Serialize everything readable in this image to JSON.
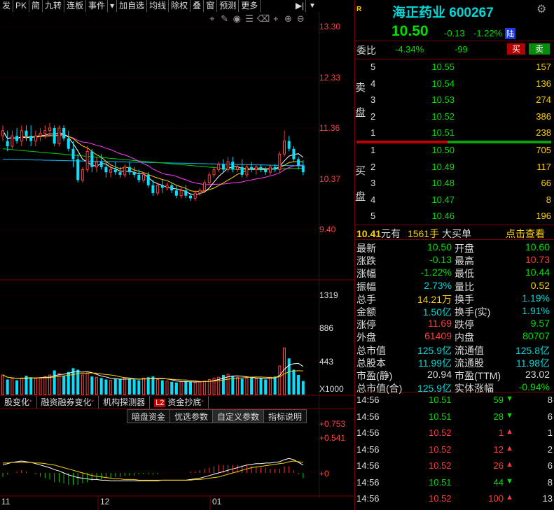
{
  "toolbar": {
    "items": [
      "发",
      "PK",
      "简",
      "九转",
      "连板",
      "事件",
      "▾",
      "加自选",
      "均线",
      "除权",
      "叠",
      "窗",
      "预测",
      "更多"
    ],
    "nav_icon": "step-right-icon",
    "dropdown_icon": "caret-down-icon"
  },
  "chart": {
    "price_axis": [
      "13.30",
      "12.33",
      "11.36",
      "10.37",
      "9.40"
    ],
    "volume_axis": [
      "1319",
      "886",
      "443",
      "X1000"
    ],
    "indicator_axis": [
      "+0.753",
      "+0.541",
      "+0"
    ],
    "date_labels": [
      "11",
      "12",
      "01"
    ],
    "tools": [
      "crosshair-icon",
      "brush-icon",
      "eye-icon",
      "layers-icon",
      "trash-icon",
      "plus-icon",
      "zoom-in-icon",
      "zoom-out-icon"
    ]
  },
  "chart_data": {
    "type": "candlestick",
    "price_ylim": [
      9.4,
      13.3
    ],
    "volume_ylim": [
      0,
      1319
    ],
    "candles": [
      {
        "o": 11.2,
        "h": 11.4,
        "l": 11.1,
        "c": 11.3
      },
      {
        "o": 11.1,
        "h": 11.3,
        "l": 10.9,
        "c": 11.0
      },
      {
        "o": 11.0,
        "h": 11.3,
        "l": 10.95,
        "c": 11.2
      },
      {
        "o": 11.2,
        "h": 11.35,
        "l": 11.05,
        "c": 11.1
      },
      {
        "o": 11.1,
        "h": 11.4,
        "l": 11.0,
        "c": 11.3
      },
      {
        "o": 11.3,
        "h": 11.4,
        "l": 11.1,
        "c": 11.2
      },
      {
        "o": 11.2,
        "h": 11.4,
        "l": 11.0,
        "c": 11.1
      },
      {
        "o": 11.1,
        "h": 11.3,
        "l": 11.0,
        "c": 11.2
      },
      {
        "o": 11.2,
        "h": 11.35,
        "l": 11.1,
        "c": 11.25
      },
      {
        "o": 11.25,
        "h": 11.4,
        "l": 11.15,
        "c": 11.3
      },
      {
        "o": 11.3,
        "h": 11.45,
        "l": 11.2,
        "c": 11.35
      },
      {
        "o": 11.35,
        "h": 11.4,
        "l": 11.0,
        "c": 11.05
      },
      {
        "o": 11.05,
        "h": 11.4,
        "l": 11.0,
        "c": 11.35
      },
      {
        "o": 11.35,
        "h": 11.4,
        "l": 11.1,
        "c": 11.15
      },
      {
        "o": 11.15,
        "h": 11.3,
        "l": 10.9,
        "c": 10.95
      },
      {
        "o": 10.95,
        "h": 11.1,
        "l": 10.6,
        "c": 10.75
      },
      {
        "o": 10.75,
        "h": 10.85,
        "l": 10.3,
        "c": 10.35
      },
      {
        "o": 10.35,
        "h": 10.6,
        "l": 10.3,
        "c": 10.55
      },
      {
        "o": 10.55,
        "h": 11.0,
        "l": 10.5,
        "c": 10.9
      },
      {
        "o": 10.9,
        "h": 10.95,
        "l": 10.5,
        "c": 10.6
      },
      {
        "o": 10.6,
        "h": 10.8,
        "l": 10.5,
        "c": 10.7
      },
      {
        "o": 10.7,
        "h": 10.85,
        "l": 10.55,
        "c": 10.6
      },
      {
        "o": 10.6,
        "h": 10.7,
        "l": 10.4,
        "c": 10.5
      },
      {
        "o": 10.5,
        "h": 10.65,
        "l": 10.4,
        "c": 10.55
      },
      {
        "o": 10.55,
        "h": 10.7,
        "l": 10.45,
        "c": 10.5
      },
      {
        "o": 10.5,
        "h": 10.6,
        "l": 10.4,
        "c": 10.45
      },
      {
        "o": 10.45,
        "h": 10.65,
        "l": 10.4,
        "c": 10.6
      },
      {
        "o": 10.6,
        "h": 10.7,
        "l": 10.45,
        "c": 10.5
      },
      {
        "o": 10.5,
        "h": 10.6,
        "l": 10.4,
        "c": 10.45
      },
      {
        "o": 10.45,
        "h": 10.55,
        "l": 10.3,
        "c": 10.35
      },
      {
        "o": 10.35,
        "h": 10.5,
        "l": 10.3,
        "c": 10.45
      },
      {
        "o": 10.45,
        "h": 10.5,
        "l": 10.2,
        "c": 10.25
      },
      {
        "o": 10.25,
        "h": 10.35,
        "l": 10.05,
        "c": 10.1
      },
      {
        "o": 10.1,
        "h": 10.3,
        "l": 10.05,
        "c": 10.25
      },
      {
        "o": 10.25,
        "h": 10.35,
        "l": 10.1,
        "c": 10.2
      },
      {
        "o": 10.2,
        "h": 10.3,
        "l": 10.15,
        "c": 10.25
      },
      {
        "o": 10.25,
        "h": 10.3,
        "l": 10.1,
        "c": 10.15
      },
      {
        "o": 10.15,
        "h": 10.25,
        "l": 10.0,
        "c": 10.05
      },
      {
        "o": 10.05,
        "h": 10.2,
        "l": 10.0,
        "c": 10.15
      },
      {
        "o": 10.15,
        "h": 10.25,
        "l": 10.0,
        "c": 10.05
      },
      {
        "o": 10.05,
        "h": 10.1,
        "l": 9.95,
        "c": 10.0
      },
      {
        "o": 10.0,
        "h": 10.15,
        "l": 9.95,
        "c": 10.1
      },
      {
        "o": 10.1,
        "h": 10.2,
        "l": 10.05,
        "c": 10.15
      },
      {
        "o": 10.15,
        "h": 10.35,
        "l": 10.1,
        "c": 10.3
      },
      {
        "o": 10.3,
        "h": 10.5,
        "l": 10.25,
        "c": 10.45
      },
      {
        "o": 10.45,
        "h": 10.6,
        "l": 10.4,
        "c": 10.55
      },
      {
        "o": 10.55,
        "h": 10.7,
        "l": 10.5,
        "c": 10.65
      },
      {
        "o": 10.65,
        "h": 10.75,
        "l": 10.5,
        "c": 10.55
      },
      {
        "o": 10.55,
        "h": 10.8,
        "l": 10.5,
        "c": 10.7
      },
      {
        "o": 10.7,
        "h": 10.8,
        "l": 10.5,
        "c": 10.55
      },
      {
        "o": 10.55,
        "h": 10.65,
        "l": 10.5,
        "c": 10.6
      },
      {
        "o": 10.6,
        "h": 10.75,
        "l": 10.4,
        "c": 10.45
      },
      {
        "o": 10.45,
        "h": 10.65,
        "l": 10.4,
        "c": 10.6
      },
      {
        "o": 10.6,
        "h": 10.7,
        "l": 10.5,
        "c": 10.55
      },
      {
        "o": 10.55,
        "h": 10.65,
        "l": 10.45,
        "c": 10.6
      },
      {
        "o": 10.6,
        "h": 10.65,
        "l": 10.5,
        "c": 10.55
      },
      {
        "o": 10.55,
        "h": 10.6,
        "l": 10.45,
        "c": 10.5
      },
      {
        "o": 10.5,
        "h": 10.65,
        "l": 10.45,
        "c": 10.6
      },
      {
        "o": 10.6,
        "h": 10.65,
        "l": 10.5,
        "c": 10.55
      },
      {
        "o": 10.55,
        "h": 10.9,
        "l": 10.5,
        "c": 10.85
      },
      {
        "o": 10.85,
        "h": 11.3,
        "l": 10.8,
        "c": 11.1
      },
      {
        "o": 11.1,
        "h": 11.2,
        "l": 10.9,
        "c": 10.95
      },
      {
        "o": 10.95,
        "h": 11.0,
        "l": 10.7,
        "c": 10.75
      },
      {
        "o": 10.75,
        "h": 10.8,
        "l": 10.55,
        "c": 10.63
      },
      {
        "o": 10.63,
        "h": 10.73,
        "l": 10.44,
        "c": 10.5
      }
    ],
    "volumes": [
      260,
      200,
      210,
      190,
      220,
      250,
      230,
      210,
      220,
      240,
      260,
      320,
      280,
      250,
      300,
      350,
      330,
      260,
      280,
      240,
      230,
      220,
      200,
      190,
      210,
      200,
      220,
      210,
      200,
      190,
      220,
      230,
      240,
      200,
      190,
      180,
      170,
      160,
      170,
      180,
      170,
      160,
      170,
      180,
      200,
      220,
      230,
      260,
      270,
      250,
      230,
      210,
      220,
      230,
      210,
      220,
      200,
      230,
      240,
      380,
      620,
      480,
      330,
      260,
      180
    ],
    "mas": {
      "ma5_color": "#ffffff",
      "ma10_color": "#ffd000",
      "ma20_color": "#ff40ff",
      "ma60_color": "#00d000",
      "ma120_color": "#00c0ff"
    },
    "indicator": {
      "ylim": [
        -0.4,
        0.753
      ],
      "dif": [
        0.12,
        0.14,
        0.16,
        0.17,
        0.18,
        0.17,
        0.16,
        0.14,
        0.12,
        0.1,
        0.08,
        0.05,
        0.03,
        0.0,
        -0.03,
        -0.05,
        -0.07,
        -0.08,
        -0.09,
        -0.1,
        -0.1,
        -0.11,
        -0.11,
        -0.12,
        -0.12,
        -0.12,
        -0.12,
        -0.12,
        -0.12,
        -0.12,
        -0.12,
        -0.12,
        -0.12,
        -0.12,
        -0.11,
        -0.11,
        -0.11,
        -0.11,
        -0.11,
        -0.11,
        -0.1,
        -0.09,
        -0.08,
        -0.06,
        -0.04,
        -0.02,
        0.0,
        0.02,
        0.04,
        0.06,
        0.08,
        0.1,
        0.12,
        0.13,
        0.14,
        0.14,
        0.15,
        0.15,
        0.16,
        0.17,
        0.2,
        0.22,
        0.2,
        0.16,
        0.12
      ],
      "dea": [
        0.15,
        0.15,
        0.16,
        0.16,
        0.16,
        0.16,
        0.16,
        0.15,
        0.15,
        0.14,
        0.13,
        0.12,
        0.1,
        0.08,
        0.06,
        0.04,
        0.02,
        0.0,
        -0.02,
        -0.04,
        -0.05,
        -0.06,
        -0.07,
        -0.08,
        -0.09,
        -0.09,
        -0.1,
        -0.1,
        -0.1,
        -0.11,
        -0.11,
        -0.11,
        -0.11,
        -0.11,
        -0.11,
        -0.11,
        -0.11,
        -0.11,
        -0.11,
        -0.11,
        -0.11,
        -0.1,
        -0.1,
        -0.09,
        -0.08,
        -0.07,
        -0.06,
        -0.04,
        -0.02,
        0.0,
        0.02,
        0.04,
        0.06,
        0.08,
        0.09,
        0.1,
        0.11,
        0.12,
        0.13,
        0.14,
        0.15,
        0.17,
        0.18,
        0.17,
        0.16
      ]
    }
  },
  "tabs_row1": [
    "股变化",
    "融资融券变化",
    "机构探测器",
    "L2",
    "资金抄底"
  ],
  "tabs_row2": [
    "暗盘资金",
    "优选参数",
    "自定义参数",
    "指标说明"
  ],
  "quote": {
    "badge": "R",
    "name": "海正药业 600267",
    "price": "10.50",
    "change": "-0.13",
    "change_pct": "-1.22%",
    "exchange_badge": "陆",
    "weibi_label": "委比",
    "weibi_pct": "-4.34%",
    "weibi_diff": "-99",
    "buy_btn": "买",
    "sell_btn": "卖",
    "sell_side_label": [
      "卖",
      "盘"
    ],
    "buy_side_label": [
      "买",
      "盘"
    ],
    "asks": [
      {
        "lvl": "5",
        "price": "10.55",
        "vol": "157"
      },
      {
        "lvl": "4",
        "price": "10.54",
        "vol": "136"
      },
      {
        "lvl": "3",
        "price": "10.53",
        "vol": "274"
      },
      {
        "lvl": "2",
        "price": "10.52",
        "vol": "386"
      },
      {
        "lvl": "1",
        "price": "10.51",
        "vol": "238"
      }
    ],
    "bids": [
      {
        "lvl": "1",
        "price": "10.50",
        "vol": "705"
      },
      {
        "lvl": "2",
        "price": "10.49",
        "vol": "117"
      },
      {
        "lvl": "3",
        "price": "10.48",
        "vol": "66"
      },
      {
        "lvl": "4",
        "price": "10.47",
        "vol": "8"
      },
      {
        "lvl": "5",
        "price": "10.46",
        "vol": "196"
      }
    ],
    "big_order": {
      "price": "10.41",
      "price_suffix": "元有",
      "vol": "1561手",
      "text": "大买单",
      "link": "点击查看"
    }
  },
  "stats": [
    {
      "l1": "最新",
      "v1": "10.50",
      "c1": "green",
      "l2": "开盘",
      "v2": "10.60",
      "c2": "green"
    },
    {
      "l1": "涨跌",
      "v1": "-0.13",
      "c1": "green",
      "l2": "最高",
      "v2": "10.73",
      "c2": "red"
    },
    {
      "l1": "涨幅",
      "v1": "-1.22%",
      "c1": "green",
      "l2": "最低",
      "v2": "10.44",
      "c2": "green"
    },
    {
      "l1": "振幅",
      "v1": "2.73%",
      "c1": "cyan",
      "l2": "量比",
      "v2": "0.52",
      "c2": "yellow"
    },
    {
      "l1": "总手",
      "v1": "14.21万",
      "c1": "yellow",
      "l2": "换手",
      "v2": "1.19%",
      "c2": "cyan"
    },
    {
      "l1": "金额",
      "v1": "1.50亿",
      "c1": "cyan",
      "l2": "换手(实)",
      "v2": "1.91%",
      "c2": "cyan"
    },
    {
      "l1": "涨停",
      "v1": "11.69",
      "c1": "red",
      "l2": "跌停",
      "v2": "9.57",
      "c2": "green"
    },
    {
      "l1": "外盘",
      "v1": "61409",
      "c1": "red",
      "l2": "内盘",
      "v2": "80707",
      "c2": "green"
    },
    {
      "l1": "总市值",
      "v1": "125.9亿",
      "c1": "cyan",
      "l2": "流通值",
      "v2": "125.8亿",
      "c2": "cyan"
    },
    {
      "l1": "总股本",
      "v1": "11.99亿",
      "c1": "cyan",
      "l2": "流通股",
      "v2": "11.98亿",
      "c2": "cyan"
    },
    {
      "l1": "市盈(静)",
      "v1": "20.94",
      "c1": "white",
      "l2": "市盈(TTM)",
      "v2": "23.02",
      "c2": "white"
    },
    {
      "l1": "总市值(合)",
      "v1": "125.9亿",
      "c1": "cyan",
      "l2": "实体涨幅",
      "v2": "-0.94%",
      "c2": "green"
    }
  ],
  "ticks": [
    {
      "t": "14:56",
      "p": "10.51",
      "v": "59",
      "dir": "down",
      "n": "8"
    },
    {
      "t": "14:56",
      "p": "10.51",
      "v": "28",
      "dir": "down",
      "n": "6"
    },
    {
      "t": "14:56",
      "p": "10.52",
      "v": "1",
      "dir": "up",
      "n": "1"
    },
    {
      "t": "14:56",
      "p": "10.52",
      "v": "12",
      "dir": "up",
      "n": "2"
    },
    {
      "t": "14:56",
      "p": "10.52",
      "v": "26",
      "dir": "up",
      "n": "6"
    },
    {
      "t": "14:56",
      "p": "10.51",
      "v": "44",
      "dir": "down",
      "n": "8"
    },
    {
      "t": "14:56",
      "p": "10.52",
      "v": "100",
      "dir": "up",
      "n": "13"
    }
  ]
}
